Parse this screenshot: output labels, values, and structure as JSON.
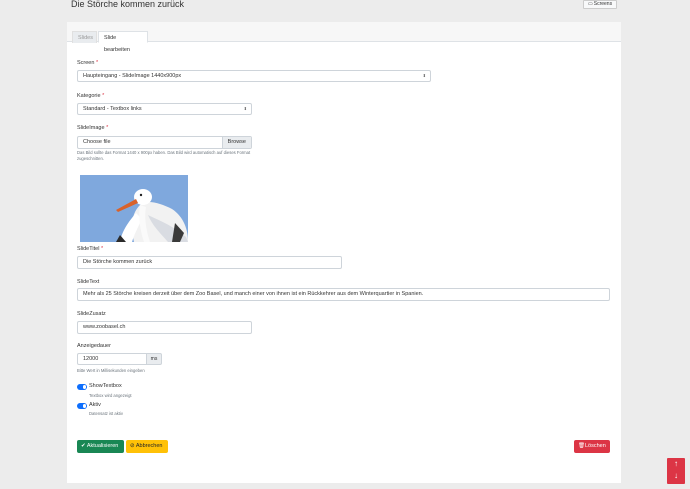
{
  "header": {
    "title": "Die Störche kommen zurück",
    "screens_label": "Screens"
  },
  "tabs": [
    {
      "label": "Slides"
    },
    {
      "label": "Slide bearbeiten"
    }
  ],
  "form": {
    "screen": {
      "label": "Screen",
      "req": "*",
      "value": "Haupteingang - SlideImage 1440x900px"
    },
    "kategorie": {
      "label": "Kategorie",
      "req": "*",
      "value": "Standard - Textbox links"
    },
    "slideimage": {
      "label": "SlideImage",
      "req": "*",
      "value": "Choose file",
      "browse": "Browse",
      "help": "Das Bild sollte das Format 1440 x 900px haben. Das Bild wird automatisch auf dieses Format zugeschnitten."
    },
    "slidetitel": {
      "label": "SlideTitel",
      "req": "*",
      "value": "Die Störche kommen zurück"
    },
    "slidetext": {
      "label": "SlideText",
      "value": "Mehr als 25 Störche kreisen derzeit über dem Zoo Basel, und manch einer von ihnen ist ein Rückkehrer aus dem Winterquartier in Spanien."
    },
    "slidezusatz": {
      "label": "SlideZusatz",
      "value": "www.zoobasel.ch"
    },
    "anzeigedauer": {
      "label": "Anzeigedauer",
      "value": "12000",
      "suffix": "ms",
      "help": "Bitte Wert in Millisekunden eingeben"
    },
    "showtextbox": {
      "label": "ShowTextbox",
      "help": "Textbox wird angezeigt"
    },
    "aktiv": {
      "label": "Aktiv",
      "help": "Datensatz ist aktiv"
    }
  },
  "buttons": {
    "update": "Aktualisieren",
    "cancel": "Abbrechen",
    "delete": "Löschen"
  },
  "colors": {
    "accent": "#0d6efd",
    "success": "#198754",
    "warning": "#ffc107",
    "danger": "#dc3545"
  }
}
